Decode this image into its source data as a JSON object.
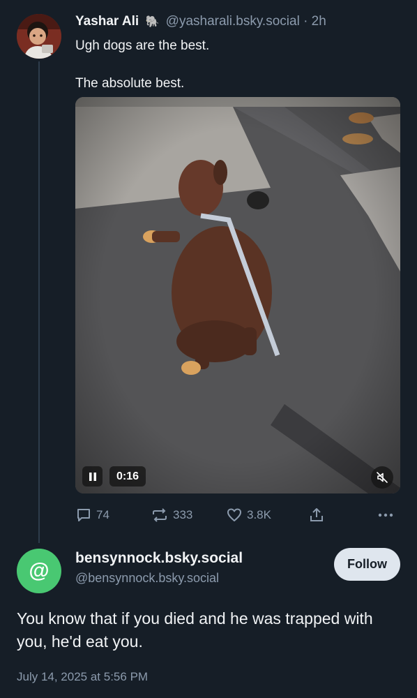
{
  "post": {
    "author_name": "Yashar Ali",
    "author_emoji": "🐘",
    "author_handle": "@yasharali.bsky.social",
    "time_ago": "· 2h",
    "text_line1": "Ugh dogs are the best.",
    "text_line2": "The absolute best.",
    "video": {
      "time": "0:16",
      "playing": true,
      "muted": true
    },
    "counts": {
      "replies": "74",
      "reposts": "333",
      "likes": "3.8K"
    }
  },
  "reply": {
    "avatar_symbol": "@",
    "display_name": "bensynnock.bsky.social",
    "handle": "@bensynnock.bsky.social",
    "follow_label": "Follow",
    "text": "You know that if you died and he was trapped with you, he'd eat you.",
    "date": "July 14, 2025 at 5:56 PM"
  },
  "colors": {
    "background": "#161e27",
    "muted_text": "#8c9bad",
    "avatar_green": "#49c872",
    "follow_bg": "#dfe6ee"
  }
}
